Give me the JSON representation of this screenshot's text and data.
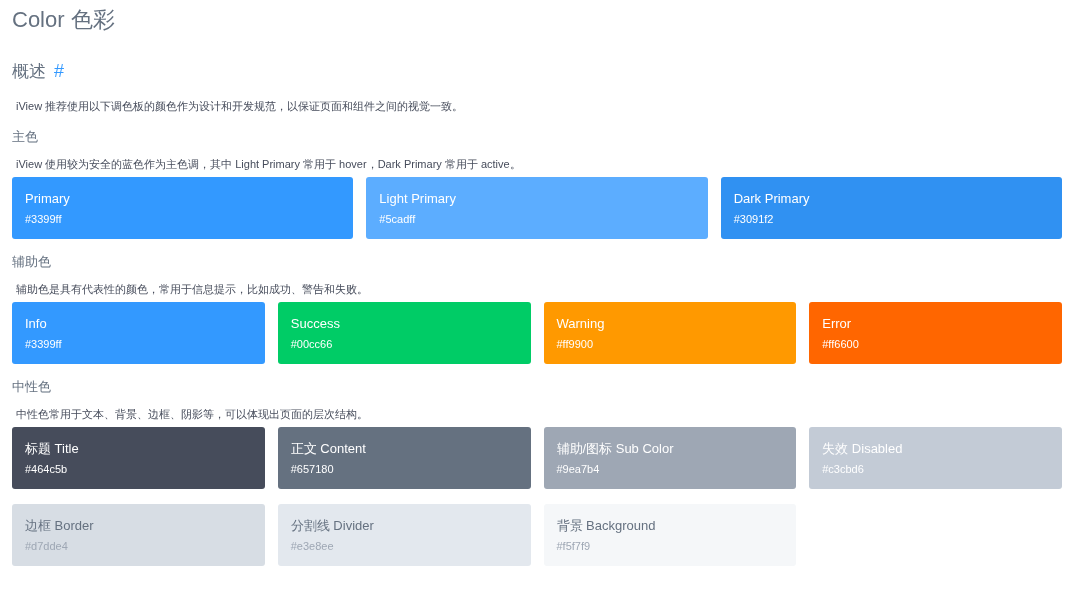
{
  "title": "Color 色彩",
  "overview": {
    "heading": "概述",
    "anchor": "#",
    "text": "iView 推荐使用以下调色板的颜色作为设计和开发规范，以保证页面和组件之间的视觉一致。"
  },
  "sections": [
    {
      "heading": "主色",
      "text": "iView 使用较为安全的蓝色作为主色调，其中 Light Primary 常用于 hover，Dark Primary 常用于 active。",
      "swatches": [
        {
          "name": "Primary",
          "hex": "#3399ff",
          "color": "#3399ff",
          "kind": "solid"
        },
        {
          "name": "Light Primary",
          "hex": "#5cadff",
          "color": "#5cadff",
          "kind": "solid"
        },
        {
          "name": "Dark Primary",
          "hex": "#3091f2",
          "color": "#3091f2",
          "kind": "solid"
        }
      ]
    },
    {
      "heading": "辅助色",
      "text": "辅助色是具有代表性的颜色，常用于信息提示，比如成功、警告和失败。",
      "swatches": [
        {
          "name": "Info",
          "hex": "#3399ff",
          "color": "#3399ff",
          "kind": "solid"
        },
        {
          "name": "Success",
          "hex": "#00cc66",
          "color": "#00cc66",
          "kind": "solid"
        },
        {
          "name": "Warning",
          "hex": "#ff9900",
          "color": "#ff9900",
          "kind": "solid"
        },
        {
          "name": "Error",
          "hex": "#ff6600",
          "color": "#ff6600",
          "kind": "solid"
        }
      ]
    },
    {
      "heading": "中性色",
      "text": "中性色常用于文本、背景、边框、阴影等，可以体现出页面的层次结构。",
      "swatches": [
        {
          "name": "标题 Title",
          "hex": "#464c5b",
          "color": "#464c5b",
          "kind": "solid"
        },
        {
          "name": "正文 Content",
          "hex": "#657180",
          "color": "#657180",
          "kind": "solid"
        },
        {
          "name": "辅助/图标 Sub Color",
          "hex": "#9ea7b4",
          "color": "#9ea7b4",
          "kind": "solid"
        },
        {
          "name": "失效 Disabled",
          "hex": "#c3cbd6",
          "color": "#c3cbd6",
          "kind": "solid"
        },
        {
          "name": "边框 Border",
          "hex": "#d7dde4",
          "color": "#d7dde4",
          "kind": "pale"
        },
        {
          "name": "分割线 Divider",
          "hex": "#e3e8ee",
          "color": "#e3e8ee",
          "kind": "pale"
        },
        {
          "name": "背景 Background",
          "hex": "#f5f7f9",
          "color": "#f5f7f9",
          "kind": "pale"
        }
      ]
    }
  ]
}
